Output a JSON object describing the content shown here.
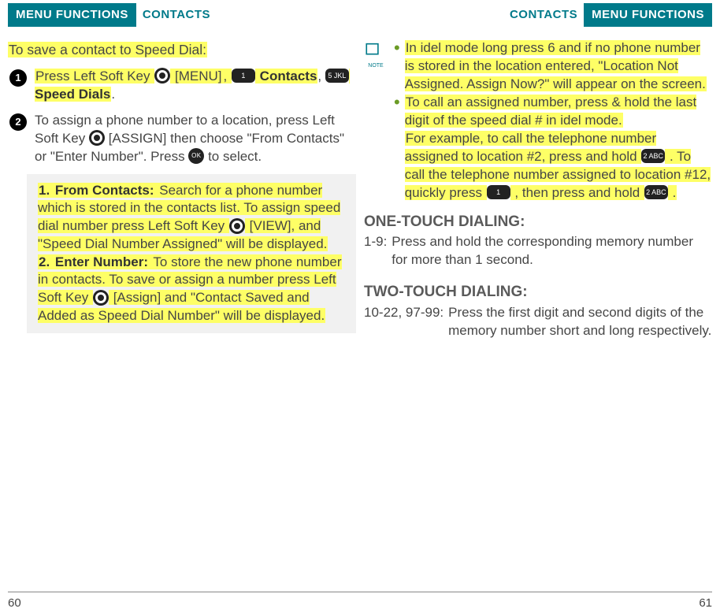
{
  "left": {
    "menu_label": "MENU FUNCTIONS",
    "section": "CONTACTS",
    "title": "To save a contact to Speed Dial:",
    "step1_a": "Press Left Soft Key ",
    "step1_b": " [MENU]",
    "step1_c": ", ",
    "step1_key1": "1",
    "step1_d": " Contacts",
    "step1_e": ", ",
    "step1_key5": "5 JKL",
    "step1_f": " Speed Dials",
    "step1_g": ".",
    "step2_a": "To assign a phone number to a location, press Left Soft Key ",
    "step2_b": " [ASSIGN] then choose \"From Contacts\" or \"Enter Number\". Press ",
    "step2_c": " to select.",
    "ok": "OK",
    "sub1_num": "1.",
    "sub1_title": " From Contacts:",
    "sub1_body1": " Search for a phone number which is stored in the contacts list. To assign speed dial number press Left Soft Key ",
    "sub1_body2": " [VIEW], and \"Speed Dial Number Assigned\" will be displayed.",
    "sub2_num": "2.",
    "sub2_title": " Enter Number:",
    "sub2_body1": " To store the new phone number in contacts. To save or assign a number press Left Soft Key ",
    "sub2_body2": " [Assign] and \"Contact Saved and Added as Speed Dial Number\" will be displayed.",
    "page_no": "60"
  },
  "right": {
    "menu_label": "MENU FUNCTIONS",
    "section": "CONTACTS",
    "note1_a": "In idel mode long press 6 and if no phone number is stored in the location entered, \"Location Not Assigned. Assign Now?\" will appear on the screen.",
    "note2_a": "To call an assigned number, press & hold the last digit of the speed dial # in idel mode.",
    "note2_b": "For example, to call the telephone number assigned to location #2, press and hold ",
    "note2_key2": "2 ABC",
    "note2_c": " . To call the telephone number assigned to location #12, quickly press ",
    "note2_key1": "1",
    "note2_d": " , then press and hold ",
    "note2_e": " .",
    "h_one": "ONE-TOUCH DIALING:",
    "one_k": "1-9:",
    "one_v": "Press and hold the corresponding memory number for more than 1 second.",
    "h_two": "TWO-TOUCH DIALING:",
    "two_k": "10-22, 97-99:",
    "two_v": "Press the first digit and second digits of the memory number short and long respectively.",
    "note_label": "NOTE",
    "page_no": "61"
  }
}
